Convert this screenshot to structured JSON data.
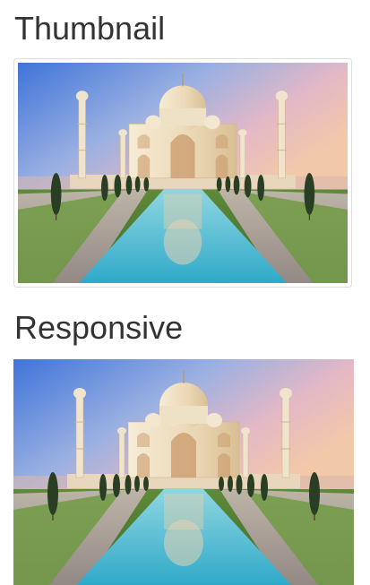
{
  "sections": [
    {
      "heading": "Thumbnail",
      "image_subject": "taj-mahal-photo"
    },
    {
      "heading": "Responsive",
      "image_subject": "taj-mahal-photo"
    }
  ],
  "colors": {
    "heading_text": "#333333",
    "thumbnail_border": "#dddddd",
    "sky_blue": "#4a7fd6",
    "sky_pink": "#e9b5c4",
    "dome_cream": "#efe2c8",
    "pool_cyan": "#5fc9d9",
    "cypress_green": "#2f4a2a"
  }
}
